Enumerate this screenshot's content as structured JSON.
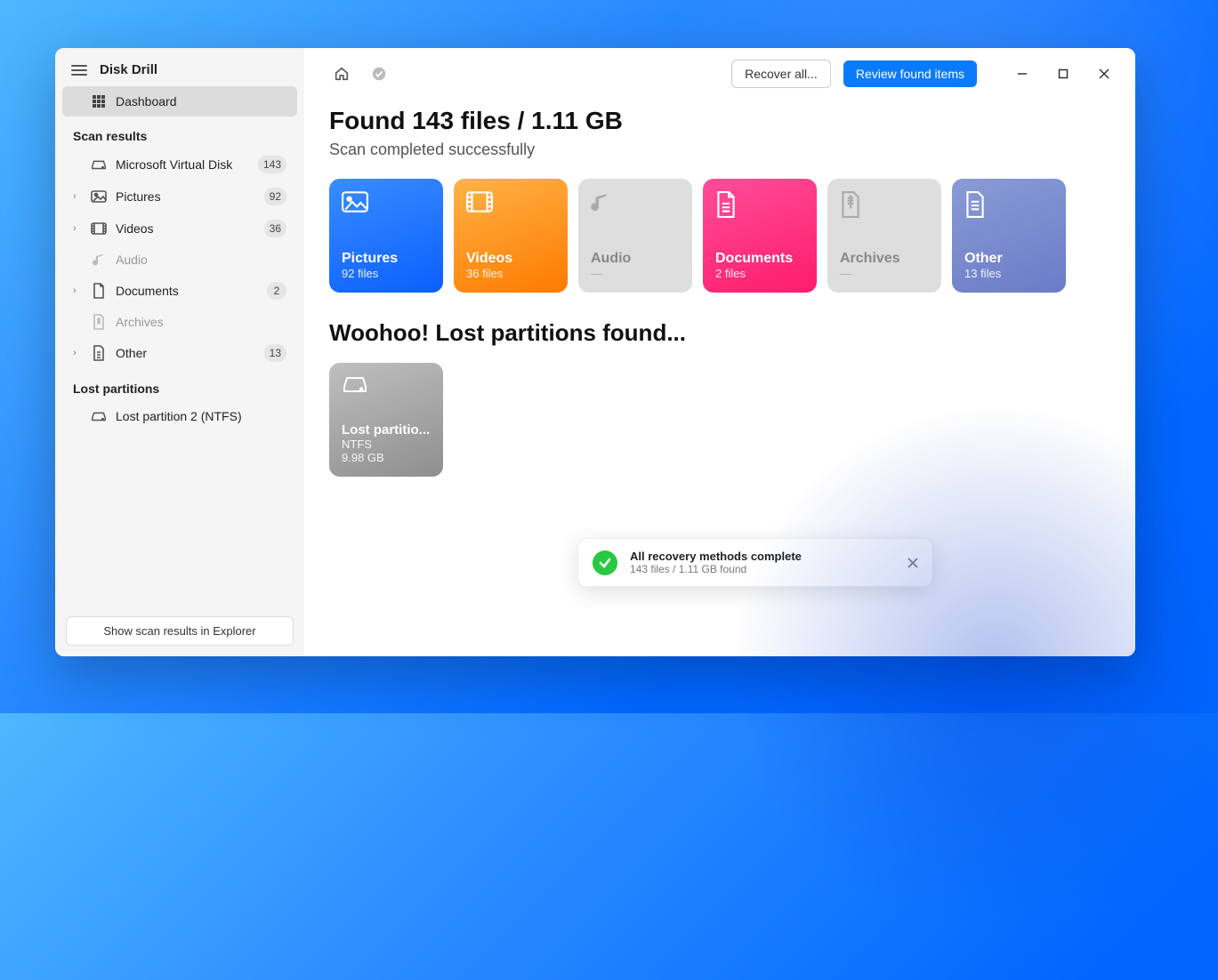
{
  "app": {
    "title": "Disk Drill"
  },
  "sidebar": {
    "dashboard": "Dashboard",
    "section_scan": "Scan results",
    "section_lost": "Lost partitions",
    "items": [
      {
        "label": "Microsoft Virtual Disk",
        "count": "143"
      },
      {
        "label": "Pictures",
        "count": "92"
      },
      {
        "label": "Videos",
        "count": "36"
      },
      {
        "label": "Audio",
        "count": ""
      },
      {
        "label": "Documents",
        "count": "2"
      },
      {
        "label": "Archives",
        "count": ""
      },
      {
        "label": "Other",
        "count": "13"
      }
    ],
    "lost": [
      {
        "label": "Lost partition 2 (NTFS)"
      }
    ],
    "footer_btn": "Show scan results in Explorer"
  },
  "topbar": {
    "recover_all": "Recover all...",
    "review": "Review found items"
  },
  "main": {
    "heading": "Found 143 files / 1.11 GB",
    "subheading": "Scan completed successfully",
    "tiles": {
      "pictures": {
        "title": "Pictures",
        "sub": "92 files"
      },
      "videos": {
        "title": "Videos",
        "sub": "36 files"
      },
      "audio": {
        "title": "Audio",
        "sub": "—"
      },
      "documents": {
        "title": "Documents",
        "sub": "2 files"
      },
      "archives": {
        "title": "Archives",
        "sub": "—"
      },
      "other": {
        "title": "Other",
        "sub": "13 files"
      }
    },
    "partitions_heading": "Woohoo! Lost partitions found...",
    "partition": {
      "title": "Lost partitio...",
      "fs": "NTFS",
      "size": "9.98 GB"
    }
  },
  "toast": {
    "title": "All recovery methods complete",
    "sub": "143 files / 1.11 GB found"
  }
}
